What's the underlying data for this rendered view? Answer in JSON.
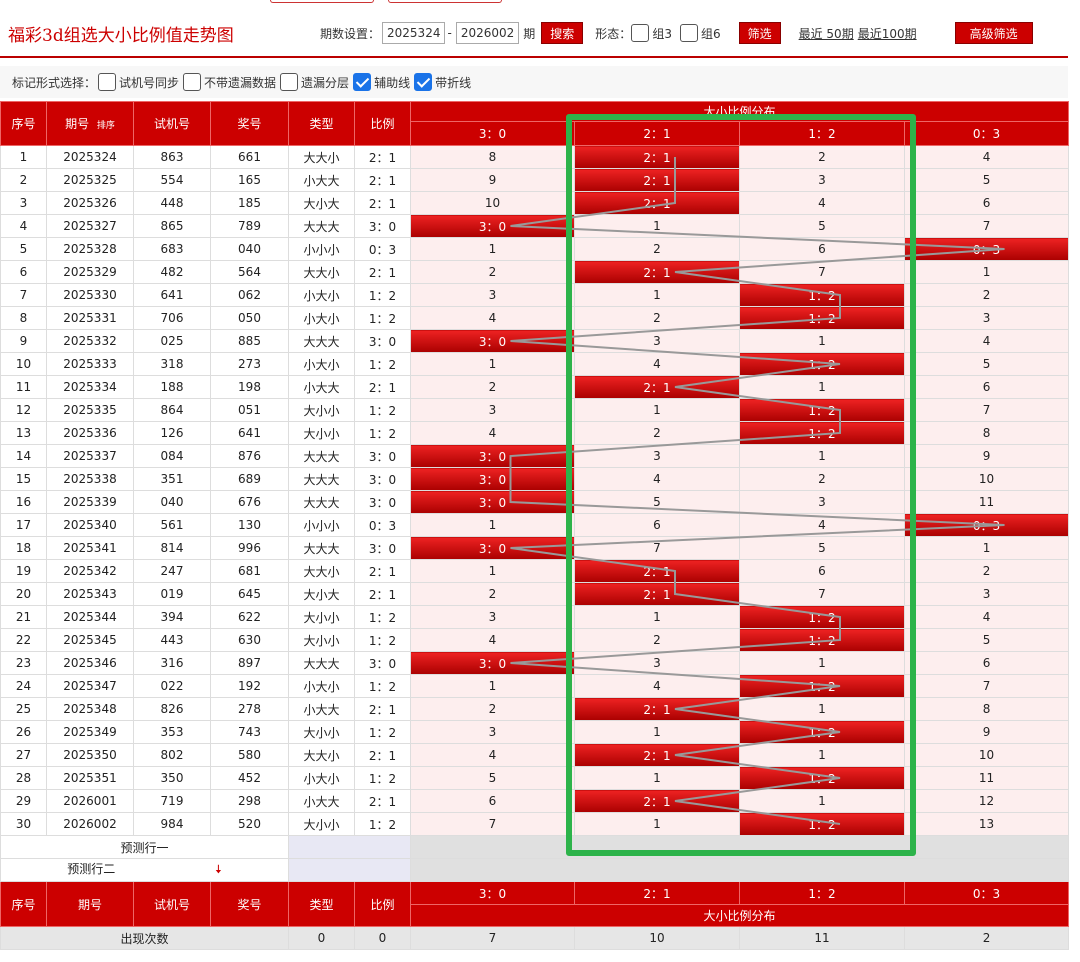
{
  "header": {
    "title": "福彩3d组选大小比例值走势图",
    "period_label": "期数设置：",
    "period_from": "2025324",
    "period_dash": "-",
    "period_to": "2026002",
    "period_unit": "期",
    "search_btn": "搜索",
    "form_label": "形态：",
    "group3": "组3",
    "group6": "组6",
    "filter_btn": "筛选",
    "recent50": "最近 50期",
    "recent100": "最近100期",
    "adv_btn": "高级筛选"
  },
  "marks": {
    "label": "标记形式选择：",
    "opt1": "试机号同步",
    "opt2": "不带遗漏数据",
    "opt3": "遗漏分层",
    "opt4": "辅助线",
    "opt5": "带折线"
  },
  "columns": {
    "seq": "序号",
    "period": "期号",
    "sort": "排序",
    "test": "试机号",
    "award": "奖号",
    "type": "类型",
    "ratio": "比例",
    "dist": "大小比例分布",
    "r": [
      "3：0",
      "2：1",
      "1：2",
      "0：3"
    ]
  },
  "rows": [
    {
      "seq": "1",
      "period": "2025324",
      "test": "863",
      "award": "661",
      "type": "大大小",
      "ratio": "2：1",
      "c": [
        "8",
        "2：1",
        "2",
        "4"
      ]
    },
    {
      "seq": "2",
      "period": "2025325",
      "test": "554",
      "award": "165",
      "type": "小大大",
      "ratio": "2：1",
      "c": [
        "9",
        "2：1",
        "3",
        "5"
      ]
    },
    {
      "seq": "3",
      "period": "2025326",
      "test": "448",
      "award": "185",
      "type": "大小大",
      "ratio": "2：1",
      "c": [
        "10",
        "2：1",
        "4",
        "6"
      ]
    },
    {
      "seq": "4",
      "period": "2025327",
      "test": "865",
      "award": "789",
      "type": "大大大",
      "ratio": "3：0",
      "c": [
        "3：0",
        "1",
        "5",
        "7"
      ]
    },
    {
      "seq": "5",
      "period": "2025328",
      "test": "683",
      "award": "040",
      "type": "小小小",
      "ratio": "0：3",
      "c": [
        "1",
        "2",
        "6",
        "0：3"
      ]
    },
    {
      "seq": "6",
      "period": "2025329",
      "test": "482",
      "award": "564",
      "type": "大大小",
      "ratio": "2：1",
      "c": [
        "2",
        "2：1",
        "7",
        "1"
      ]
    },
    {
      "seq": "7",
      "period": "2025330",
      "test": "641",
      "award": "062",
      "type": "小大小",
      "ratio": "1：2",
      "c": [
        "3",
        "1",
        "1：2",
        "2"
      ]
    },
    {
      "seq": "8",
      "period": "2025331",
      "test": "706",
      "award": "050",
      "type": "小大小",
      "ratio": "1：2",
      "c": [
        "4",
        "2",
        "1：2",
        "3"
      ]
    },
    {
      "seq": "9",
      "period": "2025332",
      "test": "025",
      "award": "885",
      "type": "大大大",
      "ratio": "3：0",
      "c": [
        "3：0",
        "3",
        "1",
        "4"
      ]
    },
    {
      "seq": "10",
      "period": "2025333",
      "test": "318",
      "award": "273",
      "type": "小大小",
      "ratio": "1：2",
      "c": [
        "1",
        "4",
        "1：2",
        "5"
      ]
    },
    {
      "seq": "11",
      "period": "2025334",
      "test": "188",
      "award": "198",
      "type": "小大大",
      "ratio": "2：1",
      "c": [
        "2",
        "2：1",
        "1",
        "6"
      ]
    },
    {
      "seq": "12",
      "period": "2025335",
      "test": "864",
      "award": "051",
      "type": "大小小",
      "ratio": "1：2",
      "c": [
        "3",
        "1",
        "1：2",
        "7"
      ]
    },
    {
      "seq": "13",
      "period": "2025336",
      "test": "126",
      "award": "641",
      "type": "大小小",
      "ratio": "1：2",
      "c": [
        "4",
        "2",
        "1：2",
        "8"
      ]
    },
    {
      "seq": "14",
      "period": "2025337",
      "test": "084",
      "award": "876",
      "type": "大大大",
      "ratio": "3：0",
      "c": [
        "3：0",
        "3",
        "1",
        "9"
      ]
    },
    {
      "seq": "15",
      "period": "2025338",
      "test": "351",
      "award": "689",
      "type": "大大大",
      "ratio": "3：0",
      "c": [
        "3：0",
        "4",
        "2",
        "10"
      ]
    },
    {
      "seq": "16",
      "period": "2025339",
      "test": "040",
      "award": "676",
      "type": "大大大",
      "ratio": "3：0",
      "c": [
        "3：0",
        "5",
        "3",
        "11"
      ]
    },
    {
      "seq": "17",
      "period": "2025340",
      "test": "561",
      "award": "130",
      "type": "小小小",
      "ratio": "0：3",
      "c": [
        "1",
        "6",
        "4",
        "0：3"
      ]
    },
    {
      "seq": "18",
      "period": "2025341",
      "test": "814",
      "award": "996",
      "type": "大大大",
      "ratio": "3：0",
      "c": [
        "3：0",
        "7",
        "5",
        "1"
      ]
    },
    {
      "seq": "19",
      "period": "2025342",
      "test": "247",
      "award": "681",
      "type": "大大小",
      "ratio": "2：1",
      "c": [
        "1",
        "2：1",
        "6",
        "2"
      ]
    },
    {
      "seq": "20",
      "period": "2025343",
      "test": "019",
      "award": "645",
      "type": "大小大",
      "ratio": "2：1",
      "c": [
        "2",
        "2：1",
        "7",
        "3"
      ]
    },
    {
      "seq": "21",
      "period": "2025344",
      "test": "394",
      "award": "622",
      "type": "大小小",
      "ratio": "1：2",
      "c": [
        "3",
        "1",
        "1：2",
        "4"
      ]
    },
    {
      "seq": "22",
      "period": "2025345",
      "test": "443",
      "award": "630",
      "type": "大小小",
      "ratio": "1：2",
      "c": [
        "4",
        "2",
        "1：2",
        "5"
      ]
    },
    {
      "seq": "23",
      "period": "2025346",
      "test": "316",
      "award": "897",
      "type": "大大大",
      "ratio": "3：0",
      "c": [
        "3：0",
        "3",
        "1",
        "6"
      ]
    },
    {
      "seq": "24",
      "period": "2025347",
      "test": "022",
      "award": "192",
      "type": "小大小",
      "ratio": "1：2",
      "c": [
        "1",
        "4",
        "1：2",
        "7"
      ]
    },
    {
      "seq": "25",
      "period": "2025348",
      "test": "826",
      "award": "278",
      "type": "小大大",
      "ratio": "2：1",
      "c": [
        "2",
        "2：1",
        "1",
        "8"
      ]
    },
    {
      "seq": "26",
      "period": "2025349",
      "test": "353",
      "award": "743",
      "type": "大小小",
      "ratio": "1：2",
      "c": [
        "3",
        "1",
        "1：2",
        "9"
      ]
    },
    {
      "seq": "27",
      "period": "2025350",
      "test": "802",
      "award": "580",
      "type": "大大小",
      "ratio": "2：1",
      "c": [
        "4",
        "2：1",
        "1",
        "10"
      ]
    },
    {
      "seq": "28",
      "period": "2025351",
      "test": "350",
      "award": "452",
      "type": "小大小",
      "ratio": "1：2",
      "c": [
        "5",
        "1",
        "1：2",
        "11"
      ]
    },
    {
      "seq": "29",
      "period": "2026001",
      "test": "719",
      "award": "298",
      "type": "小大大",
      "ratio": "2：1",
      "c": [
        "6",
        "2：1",
        "1",
        "12"
      ]
    },
    {
      "seq": "30",
      "period": "2026002",
      "test": "984",
      "award": "520",
      "type": "大小小",
      "ratio": "1：2",
      "c": [
        "7",
        "1",
        "1：2",
        "13"
      ]
    }
  ],
  "predict": {
    "row1": "预测行一",
    "row2": "预测行二"
  },
  "footer": {
    "count_label": "出现次数",
    "type_count": "0",
    "ratio_count": "0",
    "counts": [
      "7",
      "10",
      "11",
      "2"
    ]
  },
  "colors": {
    "brand": "#cc0000",
    "highlight": "#2db34a"
  }
}
